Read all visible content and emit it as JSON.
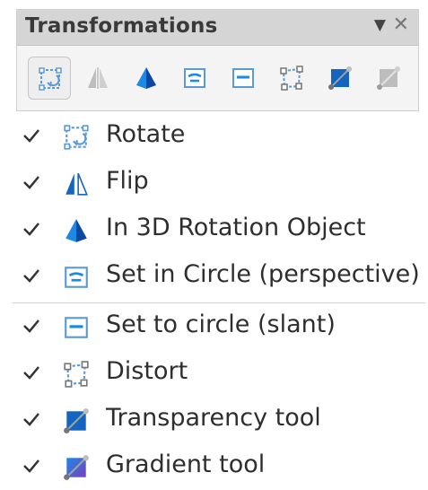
{
  "toolbar": {
    "title": "Transformations",
    "menu_glyph": "▼",
    "close_glyph": "✕",
    "tools": [
      {
        "name": "rotate-tool",
        "icon": "rotate-icon",
        "active": true
      },
      {
        "name": "flip-tool",
        "icon": "flip-icon",
        "active": false
      },
      {
        "name": "3d-rotation-tool",
        "icon": "3d-rotation-icon",
        "active": false
      },
      {
        "name": "set-in-circle-perspective-tool",
        "icon": "set-in-circle-perspective-icon",
        "active": false
      },
      {
        "name": "set-to-circle-slant-tool",
        "icon": "set-to-circle-slant-icon",
        "active": false
      },
      {
        "name": "distort-tool",
        "icon": "distort-icon",
        "active": false
      },
      {
        "name": "transparency-tool",
        "icon": "transparency-icon",
        "active": false
      },
      {
        "name": "gradient-tool",
        "icon": "gradient-icon",
        "active": false
      }
    ]
  },
  "menu": {
    "items": [
      {
        "label": "Rotate",
        "checked": true,
        "icon": "rotate-icon"
      },
      {
        "label": "Flip",
        "checked": true,
        "icon": "flip-icon"
      },
      {
        "label": "In 3D Rotation Object",
        "checked": true,
        "icon": "3d-rotation-icon"
      },
      {
        "label": "Set in Circle (perspective)",
        "checked": true,
        "icon": "set-in-circle-perspective-icon"
      },
      {
        "label": "Set to circle (slant)",
        "checked": true,
        "icon": "set-to-circle-slant-icon"
      },
      {
        "label": "Distort",
        "checked": true,
        "icon": "distort-icon"
      },
      {
        "label": "Transparency tool",
        "checked": true,
        "icon": "transparency-icon"
      },
      {
        "label": "Gradient tool",
        "checked": true,
        "icon": "gradient-icon"
      }
    ]
  },
  "colors": {
    "accent_blue": "#1565c0",
    "icon_blue_light": "#5b9bd5",
    "icon_grey": "#9e9e9e",
    "gradient_purple": "#7b3fbf"
  }
}
